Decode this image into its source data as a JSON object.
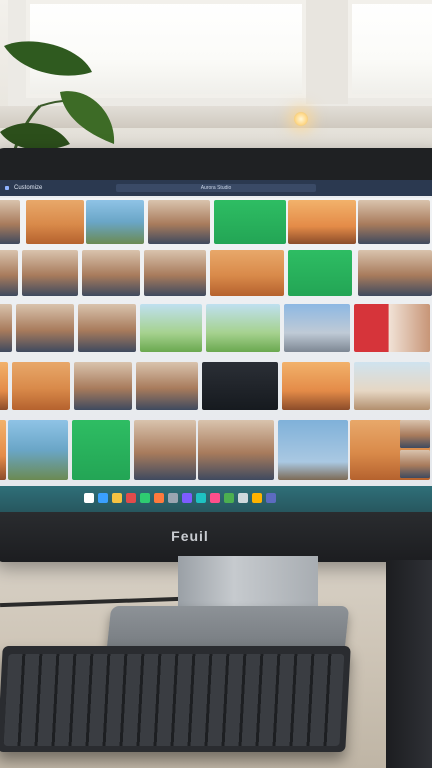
{
  "app": {
    "title": "Customize",
    "search_placeholder": "Aurora Studio"
  },
  "monitor": {
    "brand": "Feuil"
  },
  "gallery": {
    "photos": [
      "portrait-woman",
      "desert-dunes",
      "coastal-road",
      "man-with-camera",
      "green-card",
      "desert-sunset",
      "portrait-woman",
      "city-man",
      "portrait-man",
      "woman-desert",
      "man-portrait",
      "desert-dunes",
      "green-card",
      "businessman",
      "man-office",
      "man-blue-shirt",
      "woman-table",
      "woman-field",
      "green-meadow",
      "domed-building",
      "woman-red",
      "woman-sunset",
      "desert-dunes",
      "man-office",
      "man-portrait",
      "man-dark",
      "desert-sunset",
      "woman-coast",
      "desert-evening",
      "coastal-road",
      "green-card",
      "woman-portrait",
      "man-smiling",
      "eiffel-tower",
      "desert-hill",
      "woman-beach",
      "woman-smiling",
      "man-orange-cap",
      "man-white-cap",
      "woman-city",
      "man-desert",
      "child-desert"
    ]
  },
  "taskbar": {
    "icons": [
      "start-icon",
      "browser-icon",
      "files-icon",
      "mail-icon",
      "chat-icon",
      "music-icon",
      "settings-icon",
      "photos-icon",
      "store-icon",
      "video-icon",
      "maps-icon",
      "camera-icon",
      "notes-icon",
      "calendar-icon"
    ]
  },
  "colors": {
    "titlebar": "#2b3950",
    "taskbar": "#2f6f78",
    "accent_green": "#2ebd63"
  }
}
